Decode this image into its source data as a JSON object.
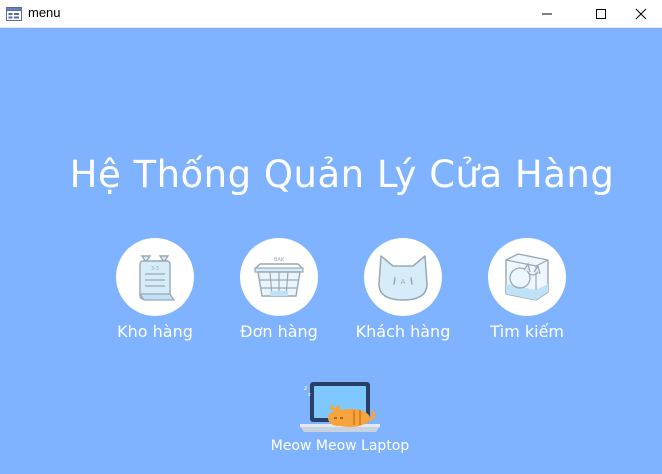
{
  "window": {
    "title": "menu",
    "icons": {
      "app": "form-icon",
      "minimize": "minimize-icon",
      "maximize": "maximize-icon",
      "close": "close-icon"
    }
  },
  "main": {
    "title": "Hệ Thống Quản Lý Cửa Hàng",
    "menu_items": [
      {
        "label": "Kho hàng",
        "icon": "inventory-box-icon"
      },
      {
        "label": "Đơn hàng",
        "icon": "shopping-basket-icon"
      },
      {
        "label": "Khách hàng",
        "icon": "cat-face-icon"
      },
      {
        "label": "Tìm kiếm",
        "icon": "cat-in-box-search-icon"
      }
    ]
  },
  "footer": {
    "label": "Meow Meow Laptop",
    "icon": "sleeping-cat-laptop-icon"
  },
  "colors": {
    "background": "#7fb3ff",
    "text": "#ffffff",
    "icon_fill": "#d6ecf9",
    "icon_stroke": "#9aa7b4"
  }
}
